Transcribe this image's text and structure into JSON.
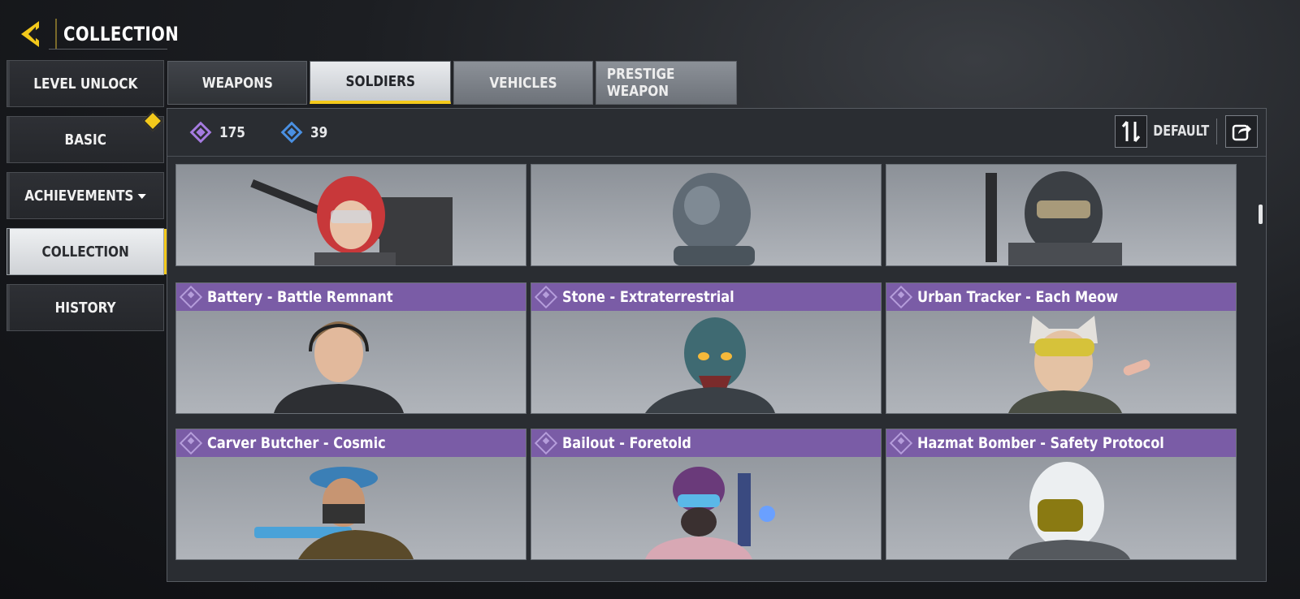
{
  "header": {
    "title": "COLLECTION",
    "back_icon": "back-arrow-icon"
  },
  "sidebar": {
    "items": [
      {
        "label": "LEVEL UNLOCK",
        "active": false
      },
      {
        "label": "BASIC",
        "active": false,
        "badge": true
      },
      {
        "label": "ACHIEVEMENTS",
        "active": false,
        "dropdown": true
      },
      {
        "label": "COLLECTION",
        "active": true
      },
      {
        "label": "HISTORY",
        "active": false
      }
    ]
  },
  "tabs": [
    {
      "label": "WEAPONS",
      "active": false
    },
    {
      "label": "SOLDIERS",
      "active": true
    },
    {
      "label": "VEHICLES",
      "active": false
    },
    {
      "label": "PRESTIGE WEAPON",
      "active": false
    }
  ],
  "currencies": [
    {
      "icon": "purple-diamond-icon",
      "value": "175",
      "color": "#a57be0"
    },
    {
      "icon": "blue-diamond-icon",
      "value": "39",
      "color": "#4a90e2"
    }
  ],
  "sort": {
    "label": "DEFAULT",
    "icon": "sort-icon",
    "share_icon": "share-icon"
  },
  "cards": [
    {
      "name": "",
      "icon": "soldier-red-helmet-portrait"
    },
    {
      "name": "",
      "icon": "soldier-astronaut-portrait"
    },
    {
      "name": "",
      "icon": "soldier-armored-helmet-portrait"
    },
    {
      "name": "Battery - Battle Remnant",
      "icon": "soldier-battery-portrait"
    },
    {
      "name": "Stone - Extraterrestrial",
      "icon": "soldier-alien-portrait"
    },
    {
      "name": "Urban Tracker - Each Meow",
      "icon": "soldier-cat-helmet-portrait"
    },
    {
      "name": "Carver Butcher - Cosmic",
      "icon": "soldier-beret-portrait"
    },
    {
      "name": "Bailout - Foretold",
      "icon": "soldier-goggles-portrait"
    },
    {
      "name": "Hazmat Bomber - Safety Protocol",
      "icon": "soldier-hazmat-portrait"
    }
  ],
  "colors": {
    "accent": "#f3c91b",
    "rarity": "#7a5ca6"
  }
}
